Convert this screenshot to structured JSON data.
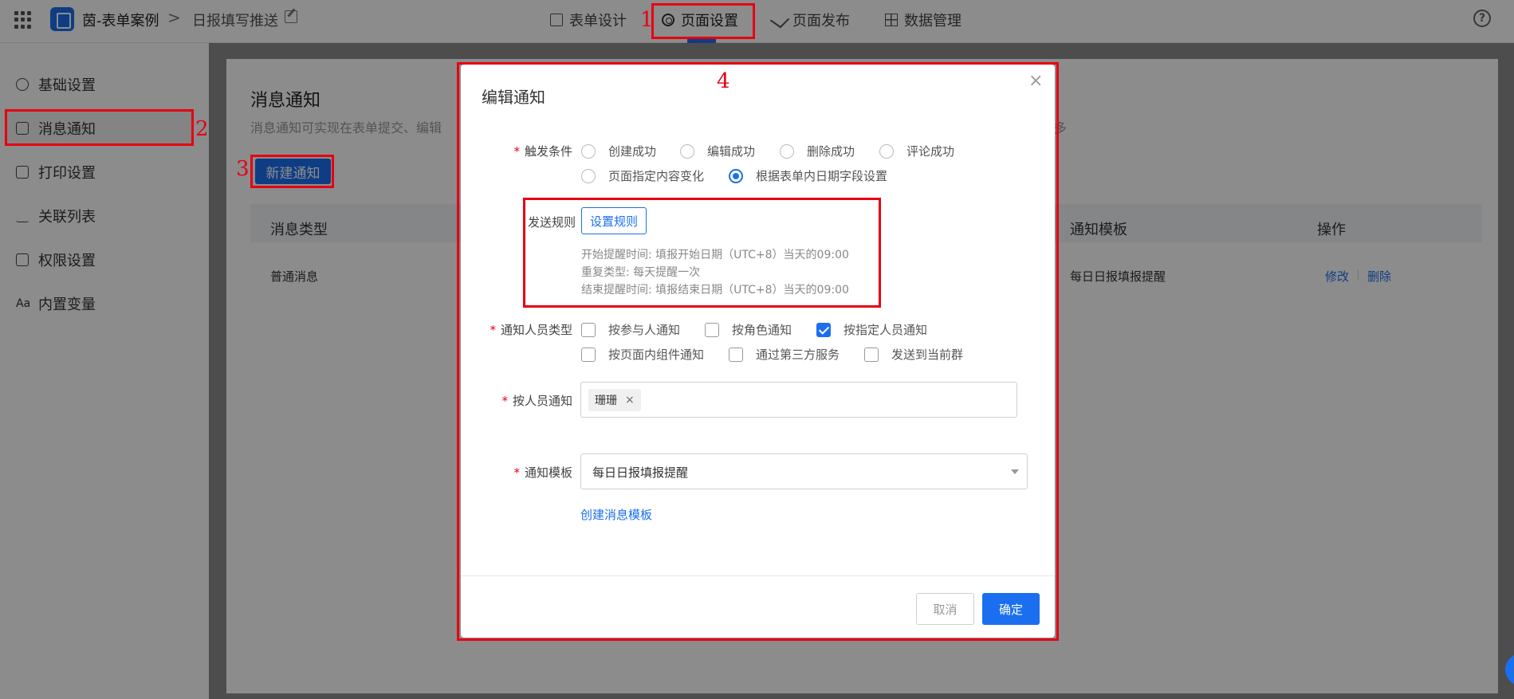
{
  "topbar": {
    "app_name": "茵-表单案例",
    "breadcrumb_sep": ">",
    "form_name": "日报填写推送",
    "tabs": [
      {
        "label": "表单设计"
      },
      {
        "label": "页面设置"
      },
      {
        "label": "页面发布"
      },
      {
        "label": "数据管理"
      }
    ],
    "help": "?"
  },
  "sidebar": {
    "items": [
      {
        "label": "基础设置"
      },
      {
        "label": "消息通知"
      },
      {
        "label": "打印设置"
      },
      {
        "label": "关联列表"
      },
      {
        "label": "权限设置"
      },
      {
        "label": "内置变量"
      }
    ]
  },
  "main": {
    "title": "消息通知",
    "desc": "消息通知可实现在表单提交、编辑",
    "desc_tail": "多",
    "new_button": "新建通知",
    "columns": [
      "消息类型",
      "通知模板",
      "操作"
    ],
    "row": {
      "type": "普通消息",
      "template": "每日日报填报提醒",
      "edit": "修改",
      "delete": "删除"
    }
  },
  "annotations": [
    "1",
    "2",
    "3",
    "4"
  ],
  "modal": {
    "title": "编辑通知",
    "close": "×",
    "trigger": {
      "label": "触发条件",
      "options": [
        "创建成功",
        "编辑成功",
        "删除成功",
        "评论成功",
        "页面指定内容变化",
        "根据表单内日期字段设置"
      ],
      "selected": "根据表单内日期字段设置"
    },
    "send_rule": {
      "label": "发送规则",
      "button": "设置规则",
      "lines": [
        "开始提醒时间: 填报开始日期（UTC+8）当天的09:00",
        "重复类型: 每天提醒一次",
        "结束提醒时间: 填报结束日期（UTC+8）当天的09:00"
      ]
    },
    "recipient_type": {
      "label": "通知人员类型",
      "options": [
        "按参与人通知",
        "按角色通知",
        "按指定人员通知",
        "按页面内组件通知",
        "通过第三方服务",
        "发送到当前群"
      ],
      "checked": [
        "按指定人员通知"
      ]
    },
    "by_person": {
      "label": "按人员通知",
      "tag": "珊珊",
      "tag_remove": "×"
    },
    "template": {
      "label": "通知模板",
      "value": "每日日报填报提醒",
      "create_link": "创建消息模板"
    },
    "cancel": "取消",
    "ok": "确定",
    "required_mark": "*"
  },
  "colors": {
    "accent": "#1a6ff0",
    "annotation": "#e60012"
  }
}
